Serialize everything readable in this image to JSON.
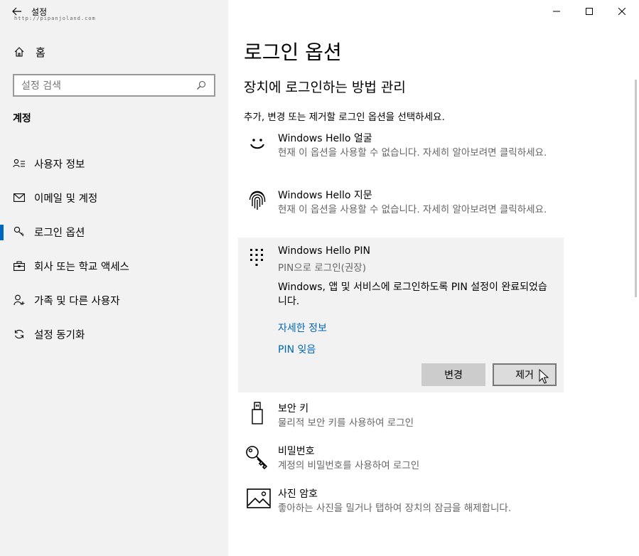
{
  "window": {
    "back_icon": "back-arrow-icon",
    "title": "설정",
    "watermark": "http://pipanjoland.com",
    "controls": [
      "minimize",
      "maximize",
      "close"
    ]
  },
  "sidebar": {
    "home_label": "홈",
    "search_placeholder": "설정 검색",
    "section_title": "계정",
    "items": [
      {
        "label": "사용자 정보",
        "icon": "user-info-icon"
      },
      {
        "label": "이메일 및 계정",
        "icon": "mail-icon"
      },
      {
        "label": "로그인 옵션",
        "icon": "key-icon",
        "active": true
      },
      {
        "label": "회사 또는 학교 액세스",
        "icon": "briefcase-icon"
      },
      {
        "label": "가족 및 다른 사용자",
        "icon": "person-add-icon"
      },
      {
        "label": "설정 동기화",
        "icon": "sync-icon"
      }
    ]
  },
  "content": {
    "page_title": "로그인 옵션",
    "subtitle": "장치에 로그인하는 방법 관리",
    "instruction": "추가, 변경 또는 제거할 로그인 옵션을 선택하세요.",
    "options": {
      "face": {
        "title": "Windows Hello 얼굴",
        "desc": "현재 이 옵션을 사용할 수 없습니다. 자세히 알아보려면 클릭하세요.",
        "icon": "smiley-face-icon"
      },
      "fingerprint": {
        "title": "Windows Hello 지문",
        "desc": "현재 이 옵션을 사용할 수 없습니다. 자세히 알아보려면 클릭하세요.",
        "icon": "fingerprint-icon"
      },
      "pin": {
        "title": "Windows Hello PIN",
        "subtitle": "PIN으로 로그인(권장)",
        "desc": "Windows, 앱 및 서비스에 로그인하도록 PIN 설정이 완료되었습니다.",
        "link_details": "자세한 정보",
        "link_forgot": "PIN 잊음",
        "btn_change": "변경",
        "btn_remove": "제거",
        "icon": "keypad-icon"
      },
      "security_key": {
        "title": "보안 키",
        "desc": "물리적 보안 키를 사용하여 로그인",
        "icon": "usb-key-icon"
      },
      "password": {
        "title": "비밀번호",
        "desc": "계정의 비밀번호를 사용하여 로그인",
        "icon": "key-icon"
      },
      "picture": {
        "title": "사진 암호",
        "desc": "좋아하는 사진을 밀거나 탭하여 장치의 잠금을 해제합니다.",
        "icon": "picture-icon"
      }
    }
  }
}
